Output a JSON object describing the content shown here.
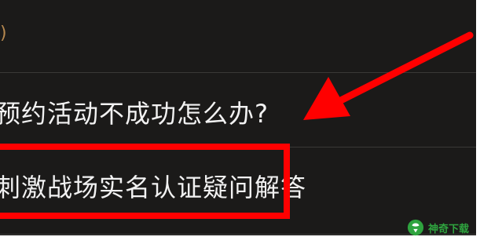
{
  "list": {
    "partial_top": ")",
    "items": [
      {
        "label": "预约活动不成功怎么办?"
      },
      {
        "label": "刺激战场实名认证疑问解答"
      }
    ]
  },
  "annotation": {
    "highlight_color": "#ff0000",
    "arrow_color": "#ff0000"
  },
  "watermark": {
    "text": "神奇下载",
    "color": "#2fa43f"
  }
}
